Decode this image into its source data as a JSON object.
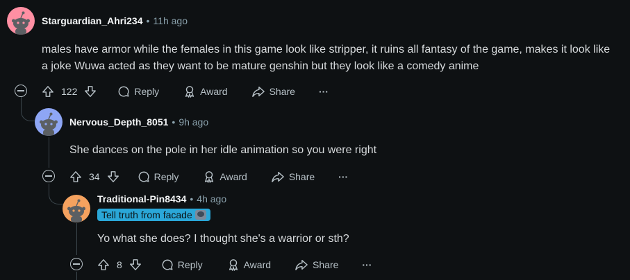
{
  "comments": [
    {
      "author": "Starguardian_Ahri234",
      "time": "11h ago",
      "text": "males have armor while the females in this game look like stripper, it ruins all fantasy of the game, makes it look like a joke Wuwa acted as they want to be mature genshin but they look like a comedy anime",
      "score": "122",
      "avatar_color": "#ff8fa3"
    },
    {
      "author": "Nervous_Depth_8051",
      "time": "9h ago",
      "text": "She dances on the pole in her idle animation so you were right",
      "score": "34",
      "avatar_color": "#8ea6f5"
    },
    {
      "author": "Traditional-Pin8434",
      "time": "4h ago",
      "flair": "Tell truth from facade",
      "text": "Yo what she does? I thought she's a warrior or sth?",
      "score": "8",
      "avatar_color": "#f5a25f"
    }
  ],
  "actions": {
    "reply": "Reply",
    "award": "Award",
    "share": "Share",
    "more": "···"
  },
  "colors": {
    "background": "#0e1113",
    "flair_bg": "#2aa7d8",
    "thread_line": "#3c474d"
  }
}
